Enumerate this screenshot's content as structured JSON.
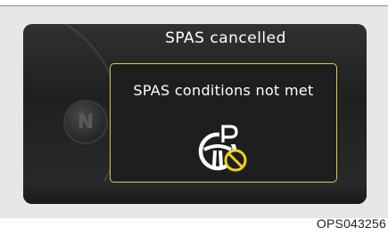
{
  "page": {
    "corner_ref": "",
    "image_code": "OPS043256"
  },
  "cluster": {
    "gear_letter": "N",
    "title": "SPAS cancelled",
    "message": "SPAS conditions not met",
    "icon": "steering-wheel-parking-prohibited-icon",
    "colors": {
      "background": "#202020",
      "text": "#ffffff",
      "box_border": "#d4cc55",
      "warning": "#f0d21e"
    }
  }
}
